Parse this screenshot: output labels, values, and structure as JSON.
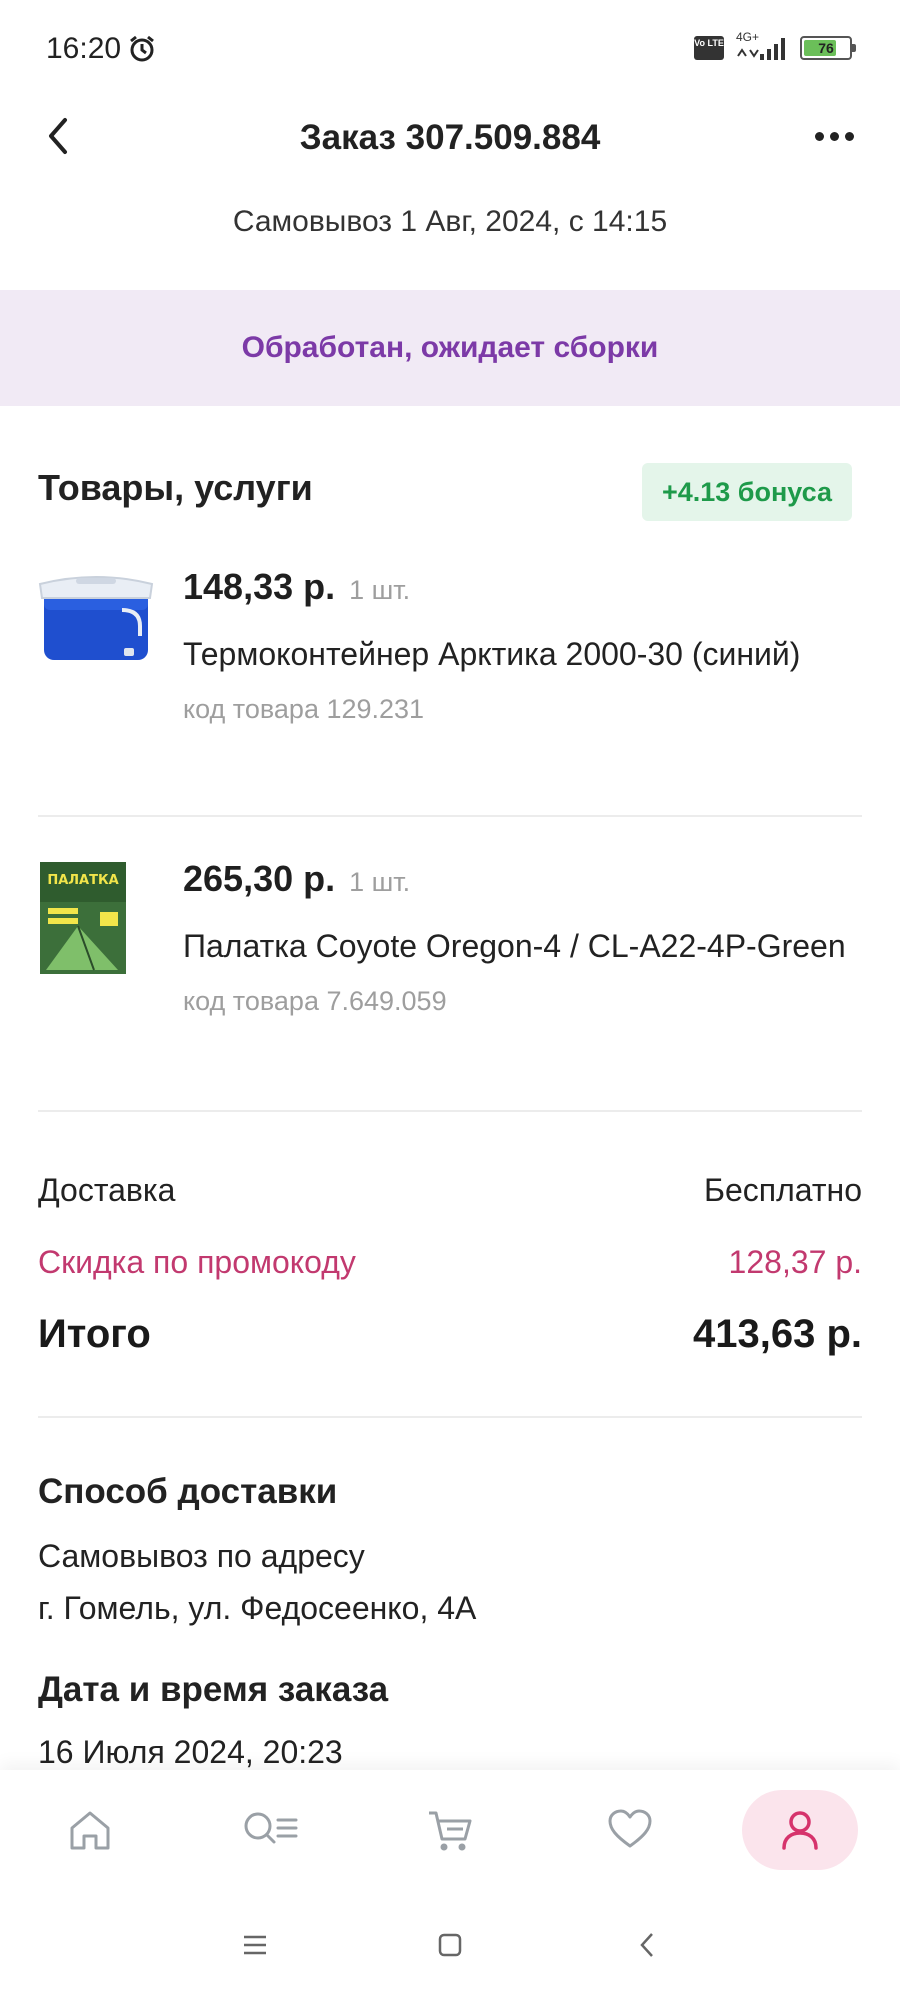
{
  "status_bar": {
    "time": "16:20",
    "network": "4G+",
    "volte": "Vo LTE",
    "battery": "76",
    "battery_level": 0.76
  },
  "header": {
    "title": "Заказ 307.509.884"
  },
  "pickup": "Самовывоз 1 Авг, 2024, с 14:15",
  "order_status": "Обработан, ожидает сборки",
  "goods": {
    "title": "Товары, услуги",
    "bonus": "+4.13 бонуса",
    "items": [
      {
        "price": "148,33 р.",
        "qty": "1 шт.",
        "name": "Термоконтейнер Арктика 2000-30 (синий)",
        "code": "код товара 129.231",
        "image_icon": "blue-cooler-box-image"
      },
      {
        "price": "265,30 р.",
        "qty": "1 шт.",
        "name": "Палатка Coyote Oregon-4 / CL-A22-4P-Green",
        "code": "код товара 7.649.059",
        "image_icon": "tent-box-image",
        "image_text": "ПАЛАТКА"
      }
    ]
  },
  "summary": {
    "delivery_label": "Доставка",
    "delivery_value": "Бесплатно",
    "discount_label": "Скидка по промокоду",
    "discount_value": "128,37 р.",
    "total_label": "Итого",
    "total_value": "413,63 р."
  },
  "delivery_method": {
    "title": "Способ доставки",
    "line1": "Самовывоз по адресу",
    "line2": "г. Гомель, ул. Федосеенко, 4А"
  },
  "order_date": {
    "title": "Дата и время заказа",
    "value": "16 Июля 2024, 20:23"
  },
  "bottom_nav": [
    "home-icon",
    "search-catalog-icon",
    "cart-icon",
    "favorites-heart-icon",
    "profile-icon"
  ],
  "colors": {
    "accent_purple": "#7c3aa7",
    "discount_pink": "#c2396f",
    "bonus_green": "#1e9a4a",
    "active_profile": "#d6336c"
  }
}
